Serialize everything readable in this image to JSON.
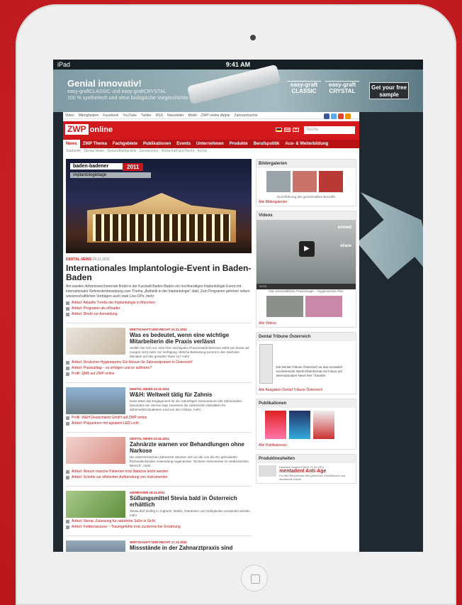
{
  "status_bar": {
    "device": "iPad",
    "time": "9:41 AM"
  },
  "ad": {
    "headline": "Genial innovativ!",
    "subline": "easy-graftCLASSIC und easy-graftCRYSTAL",
    "subline2": "100 % synthetisch und ohne biologische Vorgeschichte",
    "logo_classic": "easy-graft CLASSIC",
    "logo_crystal": "easy-graft CRYSTAL",
    "cta": "Get your free sample"
  },
  "top_links": [
    "Video",
    "Mitmgliedern",
    "Facebook",
    "YouTube",
    "Twitter",
    "RSS",
    "Newsletter",
    "Mobil",
    "ZWP online iApple",
    "Zahnarztsuche"
  ],
  "header": {
    "logo_box": "ZWP",
    "logo_text": "online",
    "search_placeholder": "Suche"
  },
  "nav": [
    "News",
    "ZWP Thema",
    "Fachgebiete",
    "Publikationen",
    "Events",
    "Unternehmen",
    "Produkte",
    "Berufspolitik",
    "Aus- & Weiterbildung"
  ],
  "breadcrumb": "Startseite · Dental News · Gesundheitspolitik · Gemesches · Wirtschaft und Recht · Archiv",
  "hero": {
    "label": "baden-badener",
    "year": "2011",
    "sub": "implantologietage"
  },
  "lead_article": {
    "tag": "DENTAL NEWS",
    "date": "24.11.2011",
    "title": "Internationales Implantologie-Event in Baden-Baden",
    "body": "Am zweiten Adventswochenende findet in der Kurstadt Baden-Baden ein hochkarätiges Implantologie-Event mit internationaler Referentenbesetzung zum Thema „Ästhetik in der Implantologie“ statt. Zum Programm gehören neben wissenschaftlichen Vorträgen auch zwei Live-OPs. mehr",
    "links": [
      "Artikel: Aktuelle Trends der Implantologie in München",
      "Artikel: Programm als eReader",
      "Artikel: Direkt zur Anmeldung"
    ]
  },
  "articles": [
    {
      "tag": "WIRTSCHAFT UND RECHT 24.11.2011",
      "title": "Was es bedeutet, wenn eine wichtige Mitarbeiterin die Praxis verlässt",
      "body": "Stellen Sie sich vor, eine Ihrer wichtigsten Praxismitarbeiterinnen steht von heute auf morgen nicht mehr zur Verfügung. Welche Bedeutung kommt in den nächsten Monaten auf das gesamte Team zu? mehr",
      "links": [
        "Artikel: Deutscher Hygienepreis 'Ein Novum für Zahnarztpraxen in Österreich'",
        "Artikel: Praxisalltag – so erfolgen und so aufhören?",
        "Profil: QM8 auf ZWP online"
      ]
    },
    {
      "tag": "DENTAL NEWS 23.11.2011",
      "title": "W&H: Weltweit tätig für Zahnis",
      "body": "Dass W&H das Engagement für die zukünftigen Generationen der Zahnmedizin besonders am Herzen liegt, beweisen die zahlreichen Aktivitäten für Zahnmedizinstudenten rund um den Globus. mehr",
      "links": [
        "Profil: W&H Deutschland GmbH auf ZWP online",
        "Artikel: Präparieren mit agnalem LED-Licht"
      ]
    },
    {
      "tag": "DENTAL NEWS 23.11.2011",
      "title": "Zahnärzte warnen vor Behandlungen ohne Narkose",
      "body": "Die österreichischen Zahnärzte stimmen sich an der von der EU geforderten flächendeckenden Anwendung sogenannter \"Sicherer Instrumente im medizinischen Bereich\". mehr",
      "links": [
        "Artikel: Warum manche Patienten trotz Narkose leicht werden",
        "Artikel: Schritte zur effizienten Aufbereitung von Instrumenten"
      ]
    },
    {
      "tag": "GENIESSEN 18.11.2011",
      "title": "Süßungsmittel Stevia bald in Österreich erhältlich",
      "body": "Stevia darf künftig in Joghurts, Müslis, Getränken und Süßigkeiten verwendet werden. mehr",
      "links": [
        "Artikel: Stevia: Zulassung für natürliche Süße in Sicht",
        "Artikel: Feldernissüsse – Traumgefühle trotz zuckerreicher Ernährung"
      ]
    },
    {
      "tag": "WIRTSCHAFT UND RECHT 17.11.2011",
      "title": "Missstände in der Zahnarztpraxis sind vermeidbar",
      "body": "",
      "links": []
    }
  ],
  "sidebar": {
    "gallery": {
      "title": "Bildergalerien",
      "caption": "Durchführung des gesetzmäßen Brusuffe",
      "link": "Alle Bildergalerien"
    },
    "videos": {
      "title": "Videos",
      "caption": "Das wirtschaftliche Praxisimage – Hygienisches Plus",
      "link": "Alle Videos",
      "embed": "embed",
      "share": "share",
      "player_time": "00:00"
    },
    "dti": {
      "title": "Dental Tribune Österreich",
      "text": "Die Dental Tribune Österreich ist das monatlich erscheinende Nachrichtenformat mit Fokus auf Internationalen News hier: Transfer.",
      "link": "Alle Ausgaben Dental Tribune Österreich"
    },
    "pubs": {
      "title": "Publikationen",
      "link": "Alle Publikationen"
    },
    "products": {
      "title": "Produktneuheiten",
      "brand": "Ultradent Austria GmbH",
      "date": "21.09.2011",
      "name": "mentadent Anti-Age",
      "text": "Für alle Bedürfnisse des gesunden Zahnfleischs und strahlende Zähne"
    }
  },
  "colors": {
    "brand_red": "#d4191c",
    "device_bg": "#cc1f24"
  }
}
